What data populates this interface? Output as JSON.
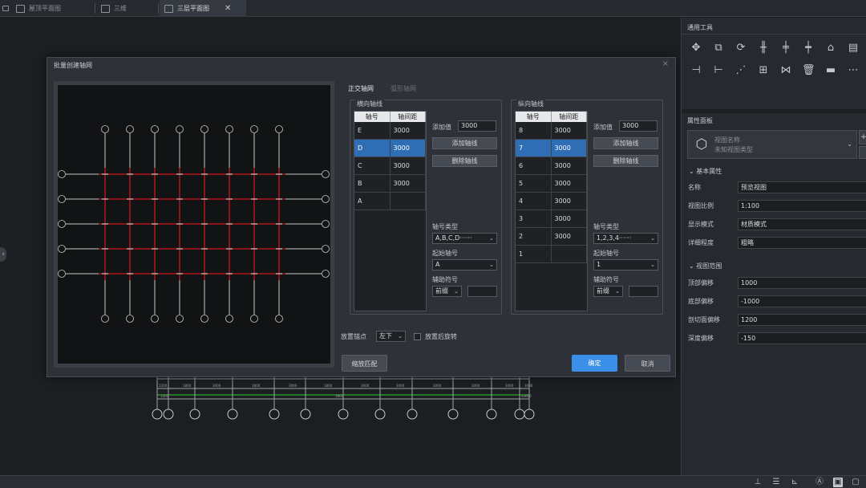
{
  "tabs": [
    {
      "label": "屋顶平面图",
      "icon": "floor-plan-icon"
    },
    {
      "label": "三维",
      "icon": "3d-view-icon"
    },
    {
      "label": "三层平面图",
      "icon": "floor-plan-icon",
      "active": true
    }
  ],
  "tab_close": "✕",
  "dialog": {
    "title": "批量创建轴网",
    "close": "×",
    "grid_tabs": {
      "orthogonal": "正交轴网",
      "radial": "弧形轴网"
    },
    "horizontal": {
      "title": "横向轴线",
      "headers": [
        "轴号",
        "轴间距"
      ],
      "rows": [
        {
          "id": "E",
          "spacing": "3000"
        },
        {
          "id": "D",
          "spacing": "3000",
          "selected": true
        },
        {
          "id": "C",
          "spacing": "3000"
        },
        {
          "id": "B",
          "spacing": "3000"
        },
        {
          "id": "A",
          "spacing": ""
        }
      ],
      "add_value_label": "添加值",
      "add_value": "3000",
      "add_button": "添加轴线",
      "delete_button": "删除轴线",
      "type_label": "轴号类型",
      "type_value": "A,B,C,D······",
      "start_label": "起始轴号",
      "start_value": "A",
      "aux_label": "辅助符号",
      "aux_value": "前缀",
      "aux_extra": ""
    },
    "vertical": {
      "title": "纵向轴线",
      "headers": [
        "轴号",
        "轴间距"
      ],
      "rows": [
        {
          "id": "8",
          "spacing": "3000"
        },
        {
          "id": "7",
          "spacing": "3000",
          "selected": true
        },
        {
          "id": "6",
          "spacing": "3000"
        },
        {
          "id": "5",
          "spacing": "3000"
        },
        {
          "id": "4",
          "spacing": "3000"
        },
        {
          "id": "3",
          "spacing": "3000"
        },
        {
          "id": "2",
          "spacing": "3000"
        },
        {
          "id": "1",
          "spacing": ""
        }
      ],
      "add_value_label": "添加值",
      "add_value": "3000",
      "add_button": "添加轴线",
      "delete_button": "删除轴线",
      "type_label": "轴号类型",
      "type_value": "1,2,3,4······",
      "start_label": "起始轴号",
      "start_value": "1",
      "aux_label": "辅助符号",
      "aux_value": "前缀",
      "aux_extra": ""
    },
    "anchor_label": "放置锚点",
    "anchor_value": "左下",
    "rotate_label": "放置后旋转",
    "rotate_checked": false,
    "zoom_fit": "缩放匹配",
    "ok": "确定",
    "cancel": "取消",
    "preview": {
      "vertical_axes": 8,
      "horizontal_axes": 5,
      "grid_color": "#c8c8c8",
      "intersection_color": "#d0161b"
    }
  },
  "sidebar": {
    "tools_title": "通用工具",
    "tool_icons_row1": [
      "move-icon",
      "copy-icon",
      "rotate-icon",
      "align-icon",
      "split-icon",
      "trim-icon",
      "paint-icon",
      "match-icon"
    ],
    "tool_icons_row2": [
      "offset-icon",
      "extend-icon",
      "array-icon",
      "group-icon",
      "mirror-icon",
      "delete-icon",
      "measure-icon",
      "more-icon"
    ],
    "props_title": "属性面板",
    "view_name_placeholder": "视图名称",
    "view_type_placeholder": "未知视图类型",
    "basic_section": "基本属性",
    "props": [
      {
        "label": "名称",
        "value": "预览视图"
      },
      {
        "label": "视图比例",
        "value": "1:100"
      },
      {
        "label": "显示模式",
        "value": "材质模式"
      },
      {
        "label": "详细程度",
        "value": "粗略"
      }
    ],
    "range_section": "视图范围",
    "range": [
      {
        "label": "顶部偏移",
        "value": "1000"
      },
      {
        "label": "底部偏移",
        "value": "-1000"
      },
      {
        "label": "剖切面偏移",
        "value": "1200"
      },
      {
        "label": "深度偏移",
        "value": "-150"
      }
    ]
  },
  "canvas_bg_labels": [
    "1200",
    "1800",
    "3000",
    "1800",
    "3000",
    "1800",
    "3000",
    "3000",
    "3000",
    "3000",
    "3000",
    "3000",
    "1800",
    "1200",
    "33600"
  ],
  "colors": {
    "accent": "#3b8fe8",
    "selected": "#2f6db5",
    "axis_red": "#d0161b",
    "dim_green": "#29d129"
  }
}
